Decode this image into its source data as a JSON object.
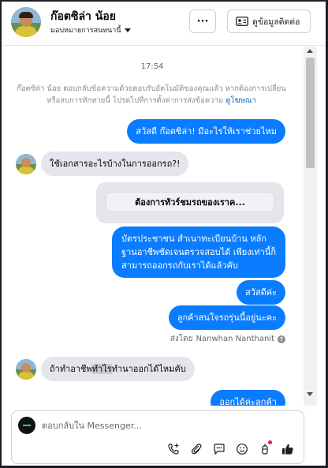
{
  "header": {
    "contact_name": "ก๊อตซิล่า น้อย",
    "assign_label": "มอบหมายการสนทนานี้",
    "more_label": "···",
    "contact_info_label": "ดูข้อมูลติดต่อ"
  },
  "chat": {
    "timestamp": "17:54",
    "notice_text": "ก๊อตซิล่า น้อย ตอบกลับข้อความด้วยตอบรับอัตโนมัติของคุณแล้ว หากต้องการเปลี่ยนหรือลบการทักทายนี้ โปรดไปที่การตั้งค่าการส่งข้อความ",
    "notice_link": "ดูโฆษณา",
    "messages": [
      {
        "dir": "out",
        "text": "สวัสดี ก๊อตซิล่า! มีอะไรให้เราช่วยไหม"
      },
      {
        "dir": "in",
        "text": "ใช้เอกสารอะไรบ้างในการออกรถ?!"
      },
      {
        "dir": "template",
        "text": "ต้องการทัวร์ชมรถของเราค..."
      },
      {
        "dir": "out",
        "lines": [
          "บัตรประชาชน สำเนาทะเบียนบ้าน หลัก",
          "ฐานอาชีพชัดเจนตรวจสอบได้ เพียงเท่านี้ก็",
          "สามารถออกรถกับเราได้แล้วคับ"
        ]
      },
      {
        "dir": "out",
        "text": "สวัสดีค่ะ"
      },
      {
        "dir": "out",
        "text": "ลูกค้าสนใจรถรุ่นนี้อยู่นะคะ"
      },
      {
        "dir": "in",
        "text_pre": "ถ้าทำอาชีพ",
        "text_hl": "ทำไร",
        "text_post": "ทำนาออกได้ไหมคับ"
      },
      {
        "dir": "out",
        "text": "ออกได้ค่ะลูกค้า"
      }
    ],
    "sent_by_prefix": "ส่งโดย",
    "sent_by_name": "Nanwhan Nanthanit"
  },
  "composer": {
    "placeholder": "ตอบกลับใน Messenger..."
  },
  "icons": [
    "add-call-icon",
    "attachment-icon",
    "saved-reply-icon",
    "emoji-icon",
    "bot-icon",
    "like-icon"
  ],
  "colors": {
    "outgoing_bubble": "#0a7cff",
    "incoming_bubble": "#e4e6eb",
    "link": "#0a66c2",
    "notification_dot": "#e41e3f"
  }
}
